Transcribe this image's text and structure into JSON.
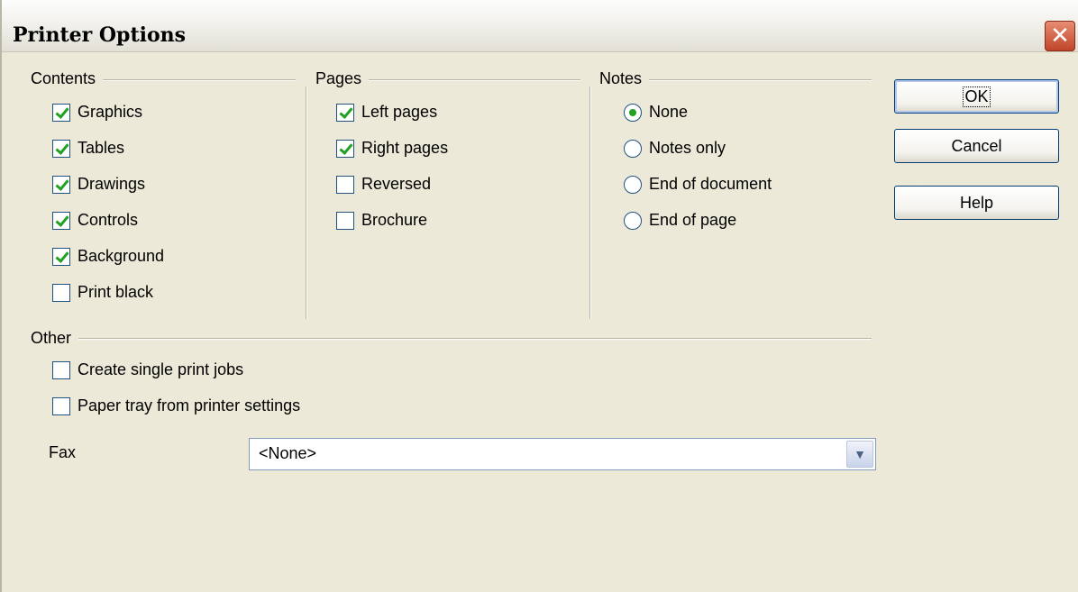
{
  "dialog": {
    "title": "Printer Options",
    "close_icon": "close-icon",
    "close_glyph": "✕"
  },
  "contents": {
    "label": "Contents",
    "items": [
      {
        "label": "Graphics",
        "checked": true
      },
      {
        "label": "Tables",
        "checked": true
      },
      {
        "label": "Drawings",
        "checked": true
      },
      {
        "label": "Controls",
        "checked": true
      },
      {
        "label": "Background",
        "checked": true
      },
      {
        "label": "Print black",
        "checked": false
      }
    ]
  },
  "pages": {
    "label": "Pages",
    "items": [
      {
        "label": "Left pages",
        "checked": true
      },
      {
        "label": "Right pages",
        "checked": true
      },
      {
        "label": "Reversed",
        "checked": false
      },
      {
        "label": "Brochure",
        "checked": false
      }
    ]
  },
  "notes": {
    "label": "Notes",
    "options": [
      {
        "label": "None",
        "selected": true
      },
      {
        "label": "Notes only",
        "selected": false
      },
      {
        "label": "End of document",
        "selected": false
      },
      {
        "label": "End of page",
        "selected": false
      }
    ]
  },
  "other": {
    "label": "Other",
    "items": [
      {
        "label": "Create single print jobs",
        "checked": false
      },
      {
        "label": "Paper tray from printer settings",
        "checked": false
      }
    ],
    "fax_label": "Fax",
    "fax_value": "<None>",
    "fax_dropdown_icon": "chevron-down-icon",
    "fax_dropdown_glyph": "▼"
  },
  "buttons": {
    "ok": "OK",
    "cancel": "Cancel",
    "help": "Help"
  },
  "colors": {
    "dialog_bg": "#ece9d8",
    "check_green": "#21a121",
    "control_border": "#1c5180",
    "close_red": "#c0452a"
  }
}
